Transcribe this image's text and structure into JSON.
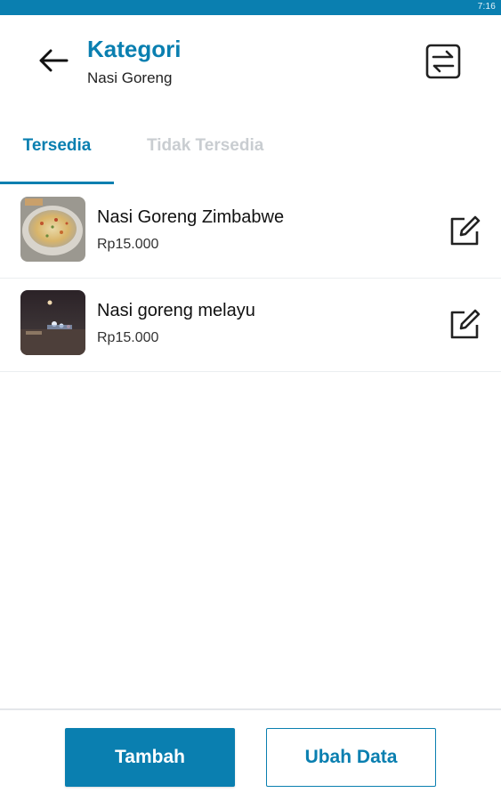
{
  "status_bar": {
    "time": "7:16"
  },
  "header": {
    "title": "Kategori",
    "subtitle": "Nasi Goreng",
    "back_icon": "arrow-left-icon",
    "sort_icon": "sort-swap-icon"
  },
  "tabs": [
    {
      "label": "Tersedia",
      "active": true
    },
    {
      "label": "Tidak Tersedia",
      "active": false
    }
  ],
  "items": [
    {
      "name": "Nasi Goreng Zimbabwe",
      "price": "Rp15.000",
      "thumbnail": "fried-rice-photo",
      "edit_icon": "edit-icon"
    },
    {
      "name": "Nasi goreng melayu",
      "price": "Rp15.000",
      "thumbnail": "night-street-photo",
      "edit_icon": "edit-icon"
    }
  ],
  "actions": {
    "add_label": "Tambah",
    "edit_data_label": "Ubah Data"
  },
  "colors": {
    "accent": "#0a7fb0",
    "inactive_tab": "#c9cdd1",
    "divider": "#ebeef0"
  }
}
